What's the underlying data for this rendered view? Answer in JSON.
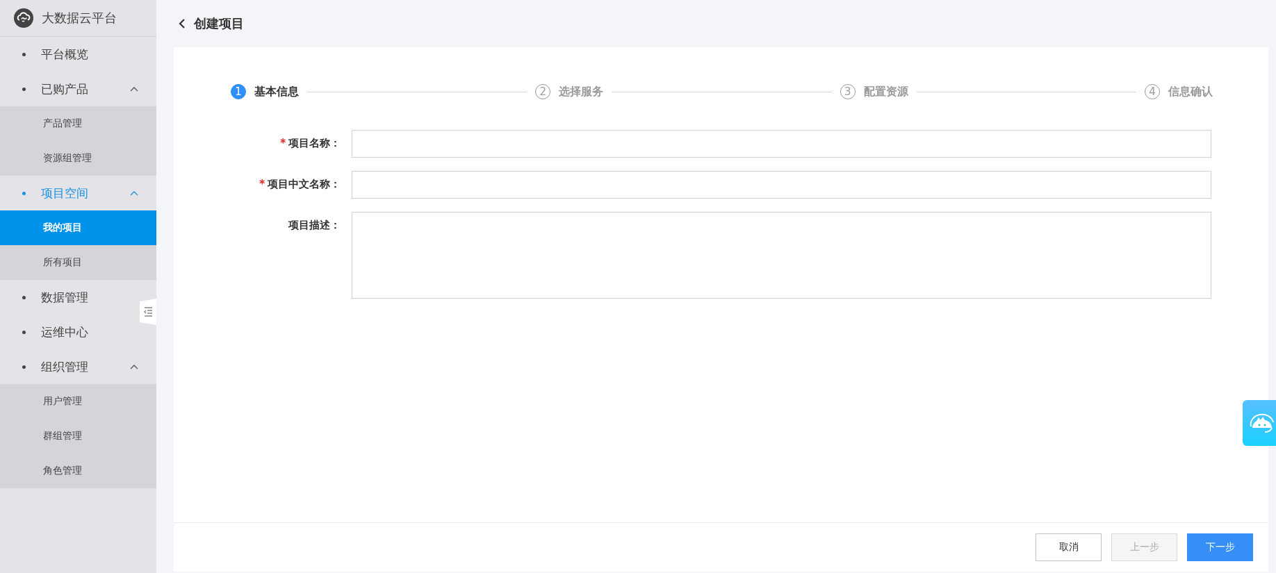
{
  "sidebar": {
    "title": "大数据云平台",
    "menu": [
      {
        "label": "平台概览",
        "selected": false
      },
      {
        "label": "已购产品",
        "selected": false,
        "expanded": true,
        "children": [
          {
            "label": "产品管理",
            "selected": false
          },
          {
            "label": "资源组管理",
            "selected": false
          }
        ]
      },
      {
        "label": "项目空间",
        "selected": true,
        "expanded": true,
        "children": [
          {
            "label": "我的项目",
            "selected": true
          },
          {
            "label": "所有项目",
            "selected": false
          }
        ]
      },
      {
        "label": "数据管理",
        "selected": false
      },
      {
        "label": "运维中心",
        "selected": false
      },
      {
        "label": "组织管理",
        "selected": false,
        "expanded": true,
        "children": [
          {
            "label": "用户管理",
            "selected": false
          },
          {
            "label": "群组管理",
            "selected": false
          },
          {
            "label": "角色管理",
            "selected": false
          }
        ]
      }
    ]
  },
  "header": {
    "title": "创建项目"
  },
  "steps": [
    {
      "number": "1",
      "label": "基本信息",
      "selected": true
    },
    {
      "number": "2",
      "label": "选择服务",
      "selected": false
    },
    {
      "number": "3",
      "label": "配置资源",
      "selected": false
    },
    {
      "number": "4",
      "label": "信息确认",
      "selected": false
    }
  ],
  "form": [
    {
      "kind": "input",
      "label": "项目名称：",
      "required_mark": "*"
    },
    {
      "kind": "input",
      "label": "项目中文名称：",
      "required_mark": "*"
    },
    {
      "kind": "textarea",
      "label": "项目描述："
    }
  ],
  "buttons": [
    {
      "kind": "default",
      "label": "取消",
      "disabled": false
    },
    {
      "kind": "default",
      "label": "上一步",
      "disabled": true
    },
    {
      "kind": "primary",
      "label": "下一步",
      "disabled": false
    }
  ]
}
